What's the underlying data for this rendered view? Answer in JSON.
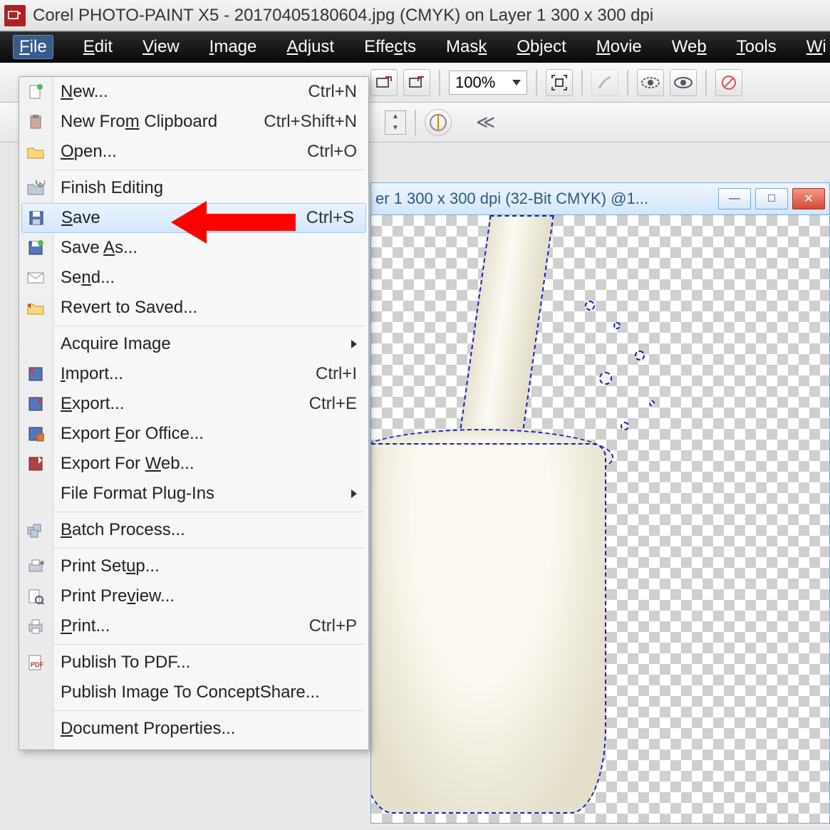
{
  "title": "Corel PHOTO-PAINT X5 - 20170405180604.jpg (CMYK) on Layer 1 300 x 300 dpi",
  "menubar": [
    "File",
    "Edit",
    "View",
    "Image",
    "Adjust",
    "Effects",
    "Mask",
    "Object",
    "Movie",
    "Web",
    "Tools",
    "Wi"
  ],
  "toolbar": {
    "zoom": "100%"
  },
  "doc_window_title": "er 1 300 x 300 dpi (32-Bit CMYK) @1...",
  "file_menu": [
    {
      "type": "item",
      "label": "New...",
      "shortcut": "Ctrl+N",
      "icon": "new"
    },
    {
      "type": "item",
      "label": "New From Clipboard",
      "shortcut": "Ctrl+Shift+N",
      "icon": "clipboard"
    },
    {
      "type": "item",
      "label": "Open...",
      "shortcut": "Ctrl+O",
      "icon": "open"
    },
    {
      "type": "sep"
    },
    {
      "type": "item",
      "label": "Finish Editing",
      "icon": "finish"
    },
    {
      "type": "item",
      "label": "Save",
      "shortcut": "Ctrl+S",
      "icon": "save",
      "highlighted": true
    },
    {
      "type": "item",
      "label": "Save As...",
      "icon": "saveas"
    },
    {
      "type": "item",
      "label": "Send...",
      "icon": "send"
    },
    {
      "type": "item",
      "label": "Revert to Saved...",
      "icon": "revert"
    },
    {
      "type": "sep"
    },
    {
      "type": "item",
      "label": "Acquire Image",
      "submenu": true
    },
    {
      "type": "item",
      "label": "Import...",
      "shortcut": "Ctrl+I",
      "icon": "import"
    },
    {
      "type": "item",
      "label": "Export...",
      "shortcut": "Ctrl+E",
      "icon": "export"
    },
    {
      "type": "item",
      "label": "Export For Office...",
      "icon": "exportoffice"
    },
    {
      "type": "item",
      "label": "Export For Web...",
      "icon": "exportweb"
    },
    {
      "type": "item",
      "label": "File Format Plug-Ins",
      "submenu": true
    },
    {
      "type": "sep"
    },
    {
      "type": "item",
      "label": "Batch Process...",
      "icon": "batch"
    },
    {
      "type": "sep"
    },
    {
      "type": "item",
      "label": "Print Setup...",
      "icon": "printsetup"
    },
    {
      "type": "item",
      "label": "Print Preview...",
      "icon": "printpreview"
    },
    {
      "type": "item",
      "label": "Print...",
      "shortcut": "Ctrl+P",
      "icon": "print"
    },
    {
      "type": "sep"
    },
    {
      "type": "item",
      "label": "Publish To PDF...",
      "icon": "pdf"
    },
    {
      "type": "item",
      "label": "Publish Image To ConceptShare..."
    },
    {
      "type": "sep"
    },
    {
      "type": "item",
      "label": "Document Properties..."
    }
  ]
}
